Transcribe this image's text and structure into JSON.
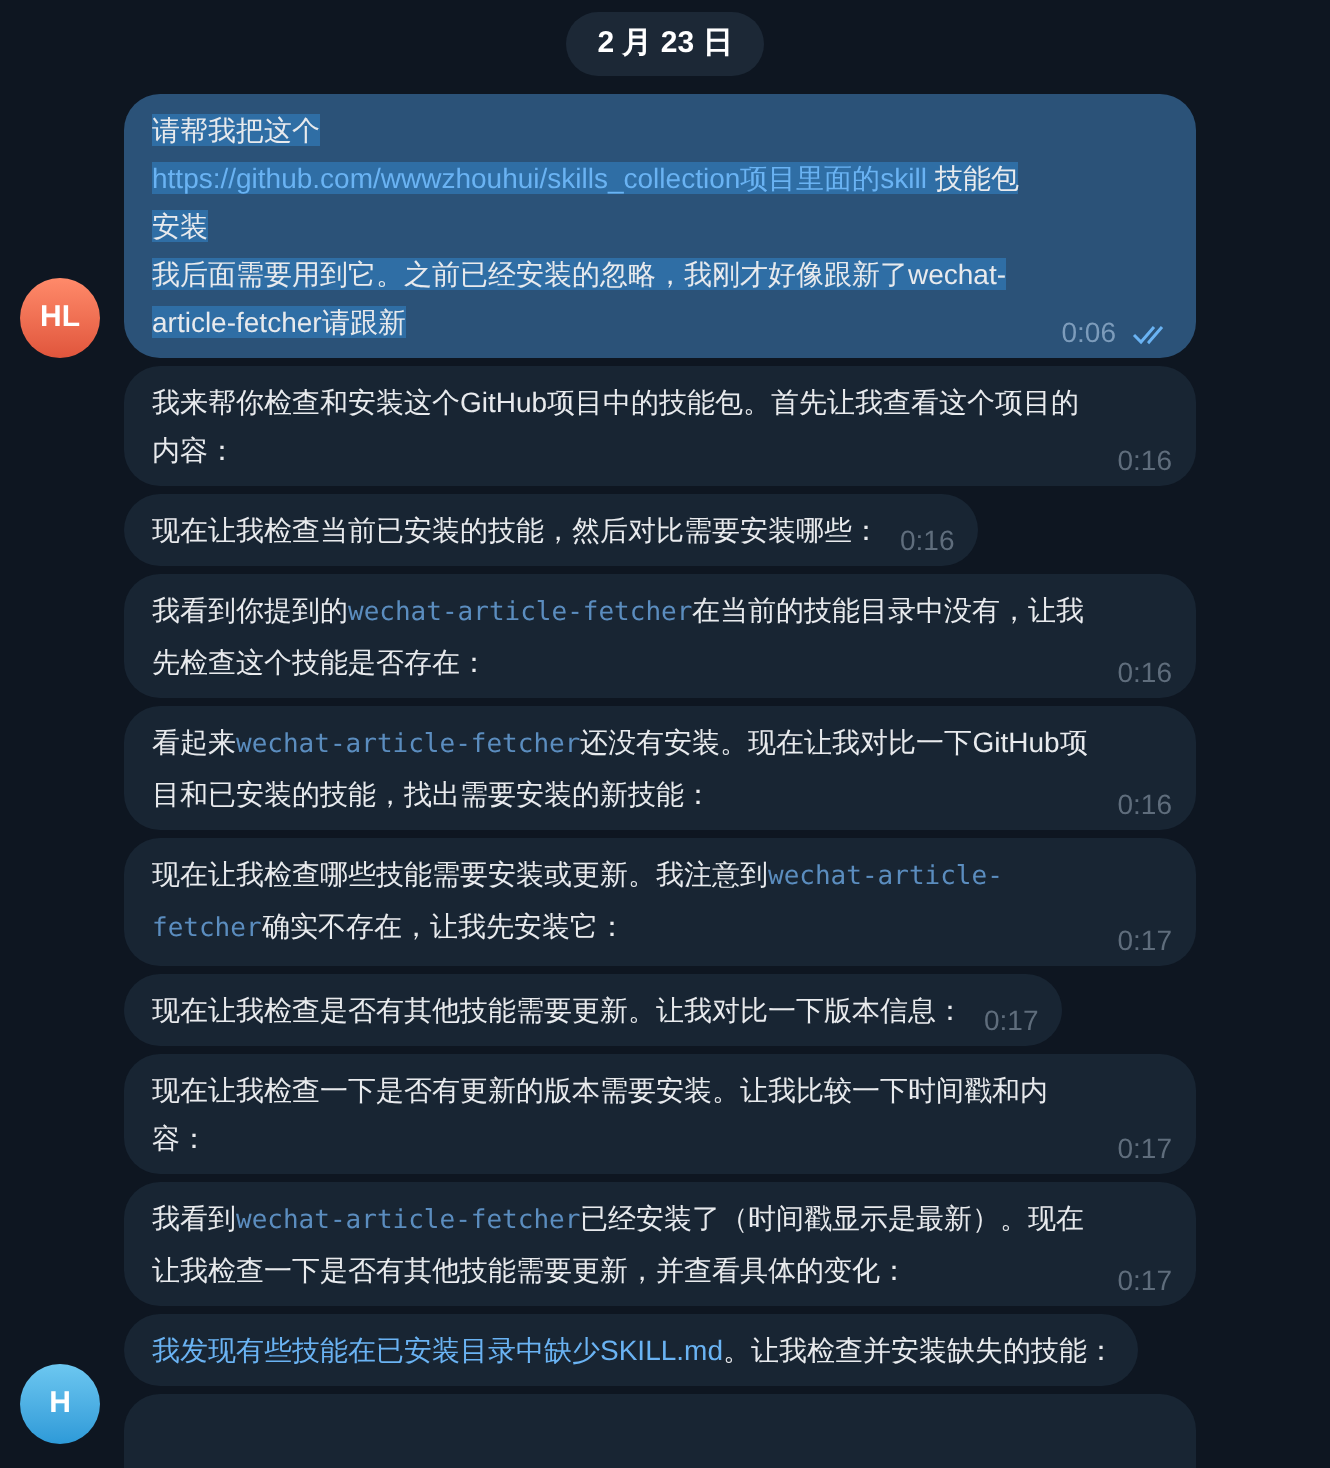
{
  "date_badge": "2 月 23 日",
  "messages": [
    {
      "avatar": "HL",
      "highlighted": true,
      "time": "0:06",
      "read": true,
      "segments": [
        {
          "kind": "text",
          "text": "请帮我把这个"
        },
        {
          "kind": "link",
          "text": "https://github.com/wwwzhouhui/skills_collection项目里面的skill"
        },
        {
          "kind": "text",
          "text": " 技能包安装"
        },
        {
          "kind": "break"
        },
        {
          "kind": "text",
          "text": "我后面需要用到它。之前已经安装的忽略，我刚才好像跟新了wechat-article-fetcher请跟新"
        }
      ]
    },
    {
      "time": "0:16",
      "segments": [
        {
          "kind": "text",
          "text": "我来帮你检查和安装这个GitHub项目中的技能包。首先让我查看这个项目的内容："
        }
      ]
    },
    {
      "time": "0:16",
      "segments": [
        {
          "kind": "text",
          "text": "现在让我检查当前已安装的技能，然后对比需要安装哪些："
        }
      ]
    },
    {
      "time": "0:16",
      "segments": [
        {
          "kind": "text",
          "text": "我看到你提到的"
        },
        {
          "kind": "code",
          "text": "wechat-article-fetcher"
        },
        {
          "kind": "text",
          "text": "在当前的技能目录中没有，让我先检查这个技能是否存在："
        }
      ]
    },
    {
      "time": "0:16",
      "segments": [
        {
          "kind": "text",
          "text": "看起来"
        },
        {
          "kind": "code",
          "text": "wechat-article-fetcher"
        },
        {
          "kind": "text",
          "text": "还没有安装。现在让我对比一下GitHub项目和已安装的技能，找出需要安装的新技能："
        }
      ]
    },
    {
      "time": "0:17",
      "segments": [
        {
          "kind": "text",
          "text": "现在让我检查哪些技能需要安装或更新。我注意到"
        },
        {
          "kind": "code",
          "text": "wechat-article-fetcher"
        },
        {
          "kind": "text",
          "text": "确实不存在，让我先安装它："
        }
      ]
    },
    {
      "time": "0:17",
      "segments": [
        {
          "kind": "text",
          "text": "现在让我检查是否有其他技能需要更新。让我对比一下版本信息："
        }
      ]
    },
    {
      "time": "0:17",
      "segments": [
        {
          "kind": "text",
          "text": "现在让我检查一下是否有更新的版本需要安装。让我比较一下时间戳和内容："
        }
      ]
    },
    {
      "time": "0:17",
      "segments": [
        {
          "kind": "text",
          "text": "我看到"
        },
        {
          "kind": "code",
          "text": "wechat-article-fetcher"
        },
        {
          "kind": "text",
          "text": "已经安装了（时间戳显示是最新）。现在让我检查一下是否有其他技能需要更新，并查看具体的变化："
        }
      ]
    },
    {
      "segments": [
        {
          "kind": "link",
          "text": "我发现有些技能在已安装目录中缺少SKILL.md"
        },
        {
          "kind": "text",
          "text": "。让我检查并安装缺失的技能："
        }
      ]
    }
  ],
  "bot_avatar": "H"
}
